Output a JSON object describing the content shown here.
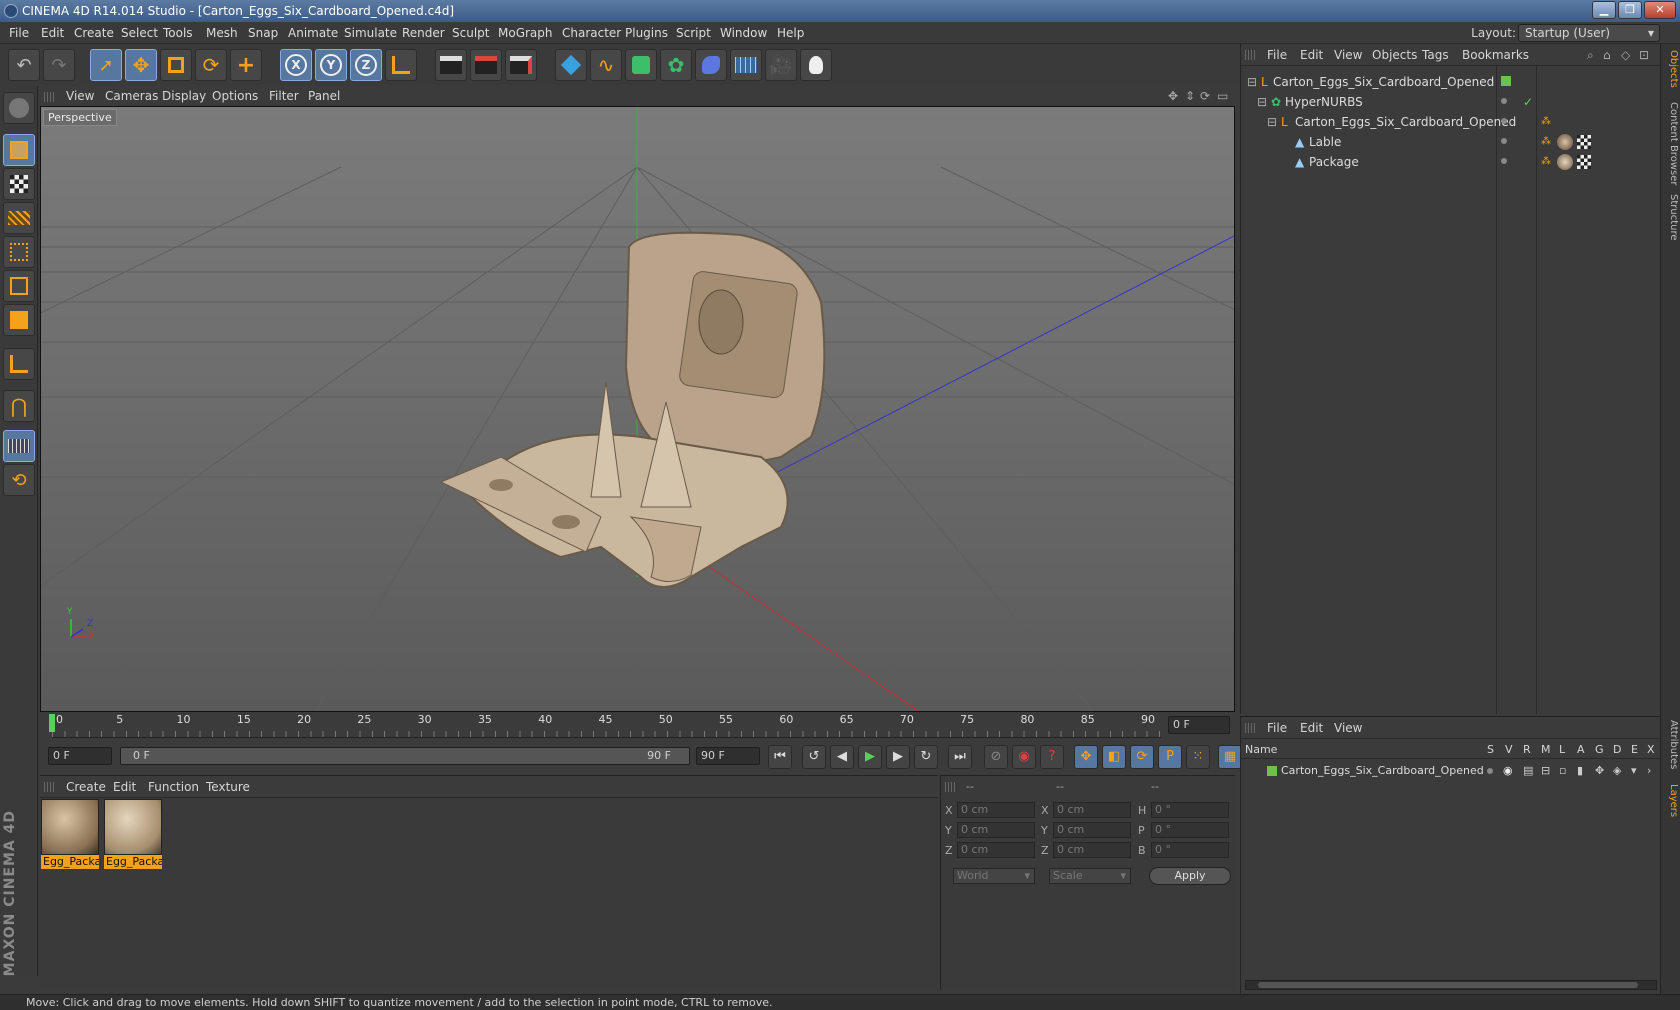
{
  "window": {
    "title": "CINEMA 4D R14.014 Studio - [Carton_Eggs_Six_Cardboard_Opened.c4d]",
    "minimize": "▁",
    "maximize": "❐",
    "close": "✕"
  },
  "menu": {
    "items": [
      "File",
      "Edit",
      "Create",
      "Select",
      "Tools",
      "Mesh",
      "Snap",
      "Animate",
      "Simulate",
      "Render",
      "Sculpt",
      "MoGraph",
      "Character",
      "Plugins",
      "Script",
      "Window",
      "Help"
    ],
    "layout_label": "Layout:",
    "layout_value": "Startup (User)"
  },
  "viewport": {
    "menu": [
      "View",
      "Cameras",
      "Display",
      "Options",
      "Filter",
      "Panel"
    ],
    "label": "Perspective",
    "axis_y": "Y",
    "axis_z": "Z",
    "axis_x": "X"
  },
  "timeline": {
    "ticks": [
      "0",
      "5",
      "10",
      "15",
      "20",
      "25",
      "30",
      "35",
      "40",
      "45",
      "50",
      "55",
      "60",
      "65",
      "70",
      "75",
      "80",
      "85",
      "90"
    ],
    "current_frame": "0 F",
    "start_field": "0 F",
    "range_start": "0 F",
    "range_end": "90 F",
    "end_field": "90 F"
  },
  "materials": {
    "menu": [
      "Create",
      "Edit",
      "Function",
      "Texture"
    ],
    "items": [
      {
        "name": "Egg_Packa"
      },
      {
        "name": "Egg_Packa"
      }
    ]
  },
  "coordinates": {
    "col_headers": [
      "--",
      "--",
      "--"
    ],
    "rows": [
      {
        "a": "X",
        "av": "0 cm",
        "b": "X",
        "bv": "0 cm",
        "c": "H",
        "cv": "0 °"
      },
      {
        "a": "Y",
        "av": "0 cm",
        "b": "Y",
        "bv": "0 cm",
        "c": "P",
        "cv": "0 °"
      },
      {
        "a": "Z",
        "av": "0 cm",
        "b": "Z",
        "bv": "0 cm",
        "c": "B",
        "cv": "0 °"
      }
    ],
    "world": "World",
    "scale": "Scale",
    "apply": "Apply"
  },
  "objects": {
    "menu": [
      "File",
      "Edit",
      "View",
      "Objects",
      "Tags",
      "Bookmarks"
    ],
    "tree": [
      {
        "name": "Carton_Eggs_Six_Cardboard_Opened",
        "indent": 0
      },
      {
        "name": "HyperNURBS",
        "indent": 1
      },
      {
        "name": "Carton_Eggs_Six_Cardboard_Opened",
        "indent": 2
      },
      {
        "name": "Lable",
        "indent": 3
      },
      {
        "name": "Package",
        "indent": 3
      }
    ]
  },
  "layers": {
    "menu": [
      "File",
      "Edit",
      "View"
    ],
    "header_name": "Name",
    "header_cols": [
      "S",
      "V",
      "R",
      "M",
      "L",
      "A",
      "G",
      "D",
      "E",
      "X"
    ],
    "rows": [
      {
        "name": "Carton_Eggs_Six_Cardboard_Opened",
        "color": "#6ec24a"
      }
    ]
  },
  "sidetabs": [
    "Objects",
    "Content Browser",
    "Structure",
    "Attributes",
    "Layers"
  ],
  "brand": "MAXON CINEMA 4D",
  "status": "Move: Click and drag to move elements. Hold down SHIFT to quantize movement / add to the selection in point mode, CTRL to remove.",
  "colors": {
    "accent": "#f4a21b",
    "selection": "#5577a0",
    "layer_green": "#6ec24a"
  }
}
